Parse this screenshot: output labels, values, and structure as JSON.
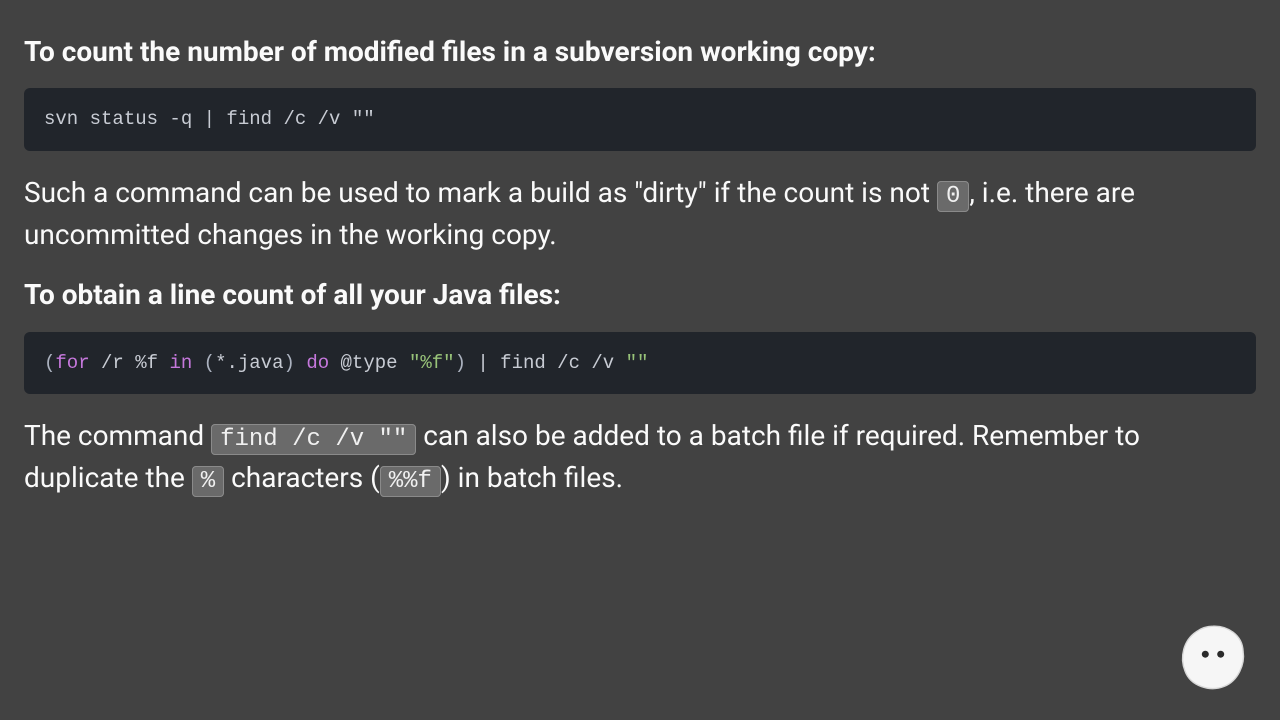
{
  "heading1": "To count the number of modified files in a subversion working copy:",
  "code1": {
    "raw": "svn status -q | find /c /v \"\""
  },
  "para1": {
    "a": "Such a command can be used to mark a build as \"dirty\" if the count is not ",
    "zero": "0",
    "b": ", i.e. there are uncommitted changes in the working copy."
  },
  "heading2": "To obtain a line count of all your Java files:",
  "code2": {
    "t0": "(",
    "t1": "for",
    "t2": " /r %f ",
    "t3": "in",
    "t4": " ",
    "t5": "(",
    "t6": "*.java",
    "t7": ")",
    "t8": " ",
    "t9": "do",
    "t10": " @type ",
    "t11": "\"%f\"",
    "t12": ")",
    "t13": " | find /c /v ",
    "t14": "\"\""
  },
  "para2": {
    "a": "The command ",
    "cmd": "find /c /v \"\"",
    "b": " can also be added to a batch file if required.  Remember to duplicate the ",
    "pct": "%",
    "c": " characters (",
    "pctf": "%%f",
    "d": ") in batch files."
  }
}
